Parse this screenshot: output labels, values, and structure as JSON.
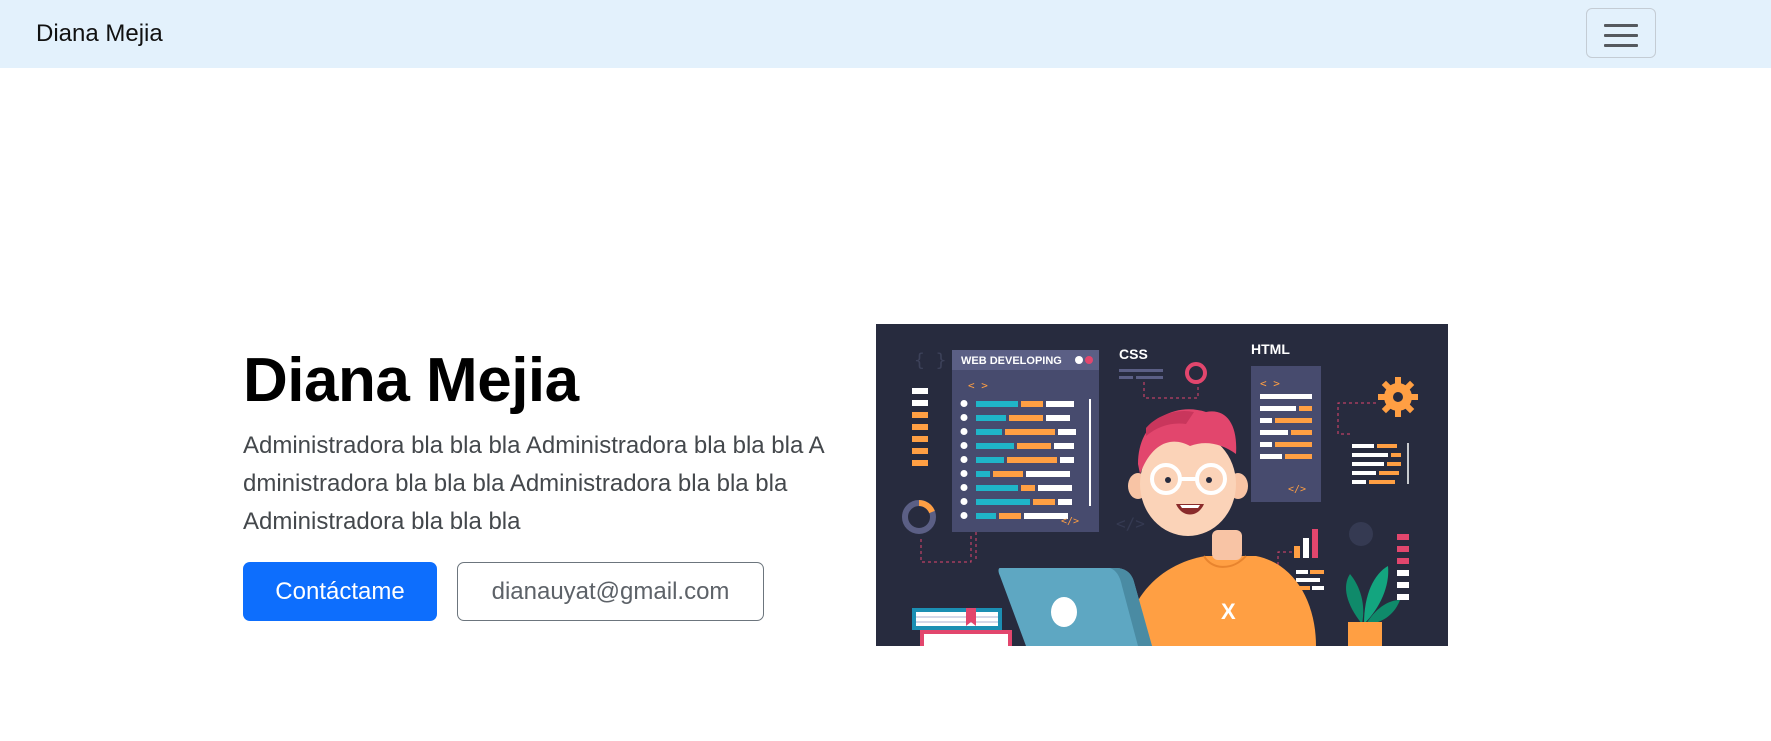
{
  "navbar": {
    "brand": "Diana Mejia",
    "toggler_icon": "hamburger-menu-icon"
  },
  "hero": {
    "title": "Diana Mejia",
    "description": "Administradora bla bla bla Administradora bla bla bla A dministradora bla bla bla Administradora bla bla bla Administradora bla bla bla",
    "contact_button": "Contáctame",
    "email_button": "dianauyat@gmail.com"
  },
  "illustration": {
    "panel_title": "WEB DEVELOPING",
    "css_label": "CSS",
    "html_label": "HTML",
    "tag_open": "< >",
    "tag_close": "</>",
    "shirt_mark": "X"
  },
  "colors": {
    "navbar_bg": "#e3f1fc",
    "primary": "#0d6efd",
    "illustration_bg": "#272b3e",
    "accent_orange": "#ff9f43",
    "accent_teal": "#1fb5c8",
    "accent_pink": "#e2466d"
  }
}
